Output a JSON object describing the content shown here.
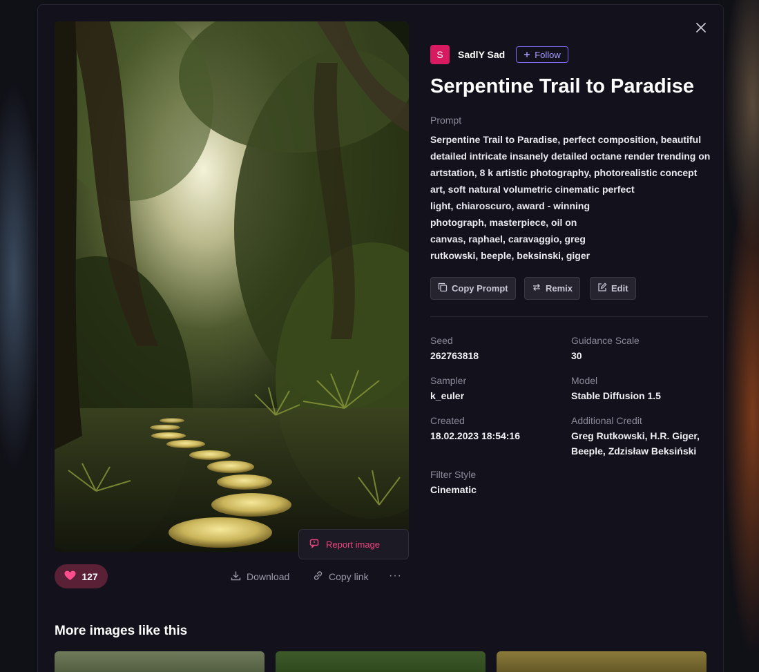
{
  "author": {
    "initial": "S",
    "name": "SadlY Sad",
    "follow_label": "Follow"
  },
  "title": "Serpentine Trail to Paradise",
  "prompt": {
    "label": "Prompt",
    "lines": [
      "Serpentine Trail to Paradise, perfect composition, beautiful",
      "detailed intricate insanely detailed octane render trending on",
      "artstation, 8 k artistic photography, photorealistic concept",
      "art, soft natural volumetric cinematic perfect",
      "light, chiaroscuro, award - winning",
      "photograph, masterpiece, oil on",
      "canvas, raphael, caravaggio, greg",
      "rutkowski, beeple, beksinski, giger"
    ]
  },
  "actions": {
    "copy_prompt": "Copy Prompt",
    "remix": "Remix",
    "edit": "Edit"
  },
  "meta": {
    "seed": {
      "label": "Seed",
      "value": "262763818"
    },
    "guidance": {
      "label": "Guidance Scale",
      "value": "30"
    },
    "sampler": {
      "label": "Sampler",
      "value": "k_euler"
    },
    "model": {
      "label": "Model",
      "value": "Stable Diffusion 1.5"
    },
    "created": {
      "label": "Created",
      "value": "18.02.2023 18:54:16"
    },
    "credit": {
      "label": "Additional Credit",
      "value_line1": "Greg Rutkowski, H.R. Giger,",
      "value_line2": "Beeple, Zdzisław Beksiński"
    },
    "filter": {
      "label": "Filter Style",
      "value": "Cinematic"
    }
  },
  "image_actions": {
    "likes": "127",
    "download": "Download",
    "copy_link": "Copy link",
    "more": "···",
    "report": "Report image"
  },
  "more_images_title": "More images like this",
  "colors": {
    "accent": "#7c6cf0",
    "report": "#f0457f",
    "like_bg": "#5a2035",
    "heart": "#ff4d8d"
  }
}
